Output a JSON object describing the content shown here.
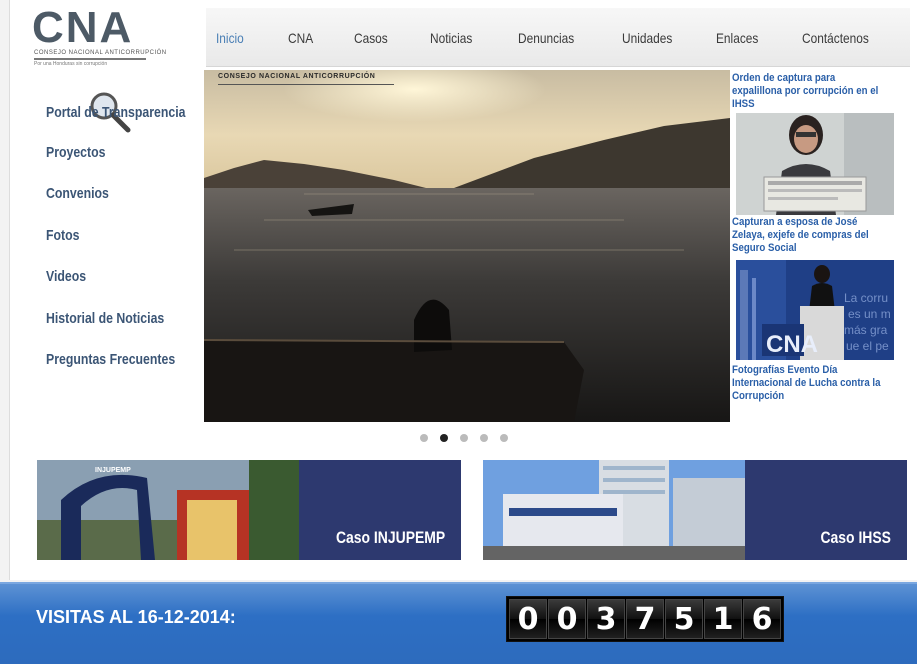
{
  "header": {
    "logo_text": "CNA",
    "logo_line1": "CONSEJO NACIONAL ANTICORRUPCIÓN",
    "logo_line2": "Por una Honduras sin corrupción",
    "nav": [
      "Inicio",
      "CNA",
      "Casos",
      "Noticias",
      "Denuncias",
      "Unidades",
      "Enlaces",
      "Contáctenos"
    ],
    "active_nav": "Inicio"
  },
  "sidebar": {
    "items": [
      "Portal de Transparencia",
      "Proyectos",
      "Convenios",
      "Fotos",
      "Videos",
      "Historial de Noticias",
      "Preguntas Frecuentes"
    ]
  },
  "hero": {
    "label": "CONSEJO NACIONAL ANTICORRUPCIÓN",
    "slide_count": 5,
    "active_slide": 2
  },
  "news": [
    {
      "title": "Orden de captura para expalillona por corrupción en el IHSS"
    },
    {
      "title": "Capturan a esposa de José Zelaya, exjefe de compras del Seguro Social",
      "thumb": "woman-holding-sign-photo"
    },
    {
      "title": "Fotografías Evento Día Internacional de Lucha contra la Corrupción",
      "thumb": "speaker-at-podium-photo"
    }
  ],
  "banners": [
    {
      "label": "Caso INJUPEMP"
    },
    {
      "label": "Caso IHSS"
    }
  ],
  "footer": {
    "visits_label": "VISITAS AL 16-12-2014:",
    "counter_digits": [
      "0",
      "0",
      "3",
      "7",
      "5",
      "1",
      "6"
    ]
  },
  "colors": {
    "nav_active": "#4a7fb5",
    "sidebar_link": "#3b5575",
    "news_link": "#2a5fa8",
    "footer_blue": "#2d6fc4"
  }
}
